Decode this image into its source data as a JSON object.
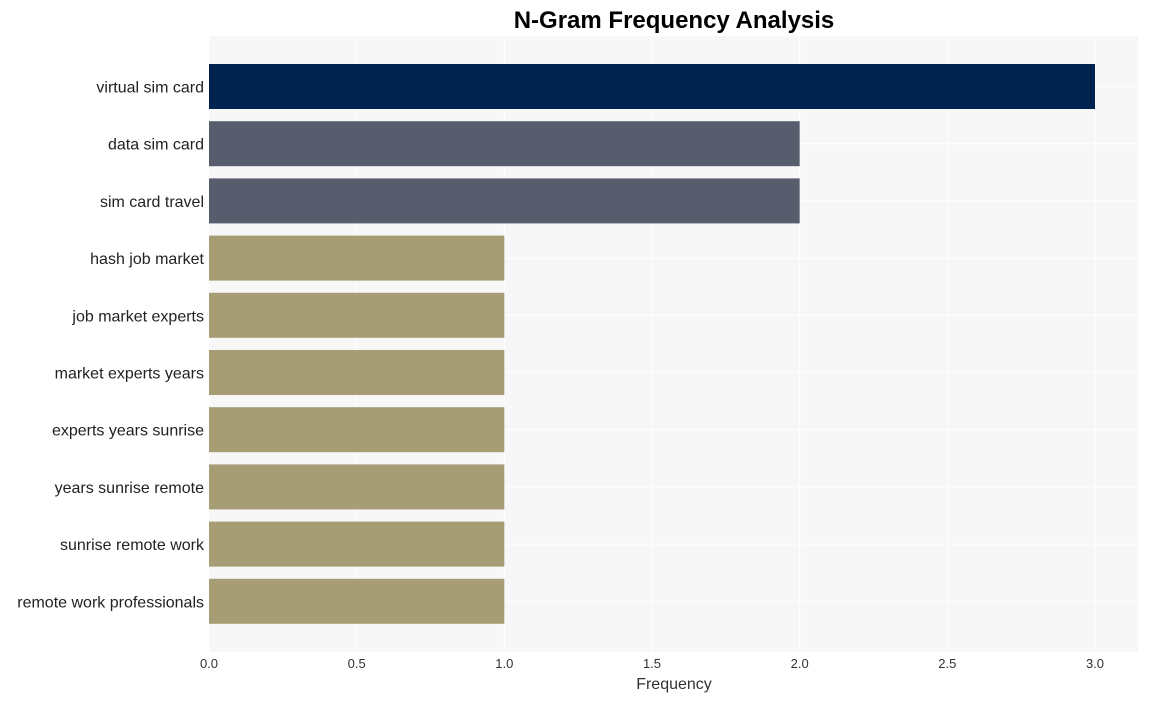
{
  "chart_data": {
    "type": "bar",
    "orientation": "horizontal",
    "title": "N-Gram Frequency Analysis",
    "xlabel": "Frequency",
    "ylabel": "",
    "xlim": [
      0,
      3.15
    ],
    "xticks": [
      "0.0",
      "0.5",
      "1.0",
      "1.5",
      "2.0",
      "2.5",
      "3.0"
    ],
    "grid": true,
    "categories": [
      "virtual sim card",
      "data sim card",
      "sim card travel",
      "hash job market",
      "job market experts",
      "market experts years",
      "experts years sunrise",
      "years sunrise remote",
      "sunrise remote work",
      "remote work professionals"
    ],
    "values": [
      3,
      2,
      2,
      1,
      1,
      1,
      1,
      1,
      1,
      1
    ],
    "colors": [
      "#00224e",
      "#575d6d",
      "#575d6d",
      "#a69d75",
      "#a69d75",
      "#a69d75",
      "#a69d75",
      "#a69d75",
      "#a69d75",
      "#a69d75"
    ],
    "background": "#f7f7f7"
  }
}
